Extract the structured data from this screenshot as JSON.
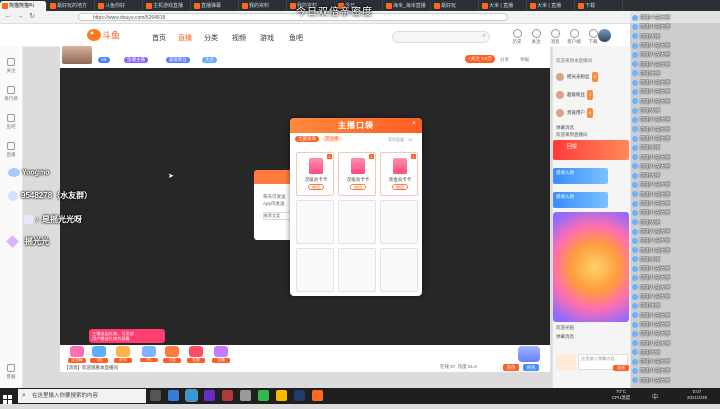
{
  "overlay_title": "今日双倍亲密度",
  "browser": {
    "tabs": [
      "熊猫熊猫叫",
      "最好玩的地方",
      "斗鱼你好",
      "主机游戏直播",
      "直播弹幕",
      "我的资料",
      "我的资料",
      "今日",
      "海米_海米直播",
      "最好玩",
      "大米 | 直播",
      "大米 | 直播",
      "下载"
    ],
    "active_tab": 0,
    "url": "https://www.douyu.com/5264818",
    "back": "←",
    "forward": "→",
    "refresh": "↻"
  },
  "header": {
    "logo": "斗鱼",
    "nav": [
      "首页",
      "直播",
      "分类",
      "视频",
      "游戏",
      "鱼吧"
    ],
    "active_nav": 1,
    "icons": [
      "历史",
      "关注",
      "消息",
      "客户端",
      "下载"
    ]
  },
  "sidebar": {
    "items": [
      "关注",
      "排行榜",
      "鱼吧",
      "直播",
      "客服"
    ]
  },
  "streamer": {
    "badges": [
      "V8",
      "鱼塘主播",
      "超级粉丝",
      "大大"
    ],
    "follow": "+关注",
    "follow_count": "3.9万",
    "share": "分享",
    "report": "举报"
  },
  "overlays": {
    "qq_prefix": "Yoogmo",
    "qq_group": "9548278（水友群）",
    "tiktok_label": "是摇光光呀",
    "name": "摇光光"
  },
  "back_card": {
    "line1": "每天可发送",
    "line2": "App内发送",
    "line3": "推荐文案"
  },
  "modal": {
    "title": "主播口袋",
    "close": "×",
    "tabs": [
      "全部道具",
      "荧光棒"
    ],
    "active_tab": 0,
    "help": "背包容量：15",
    "cards": [
      {
        "name": "次级贡卡卡",
        "count": "1",
        "action": "使用"
      },
      {
        "name": "次级贡卡卡",
        "count": "1",
        "action": "使用"
      },
      {
        "name": "黑金贡卡卡",
        "count": "1",
        "action": "使用"
      }
    ]
  },
  "gifts": [
    {
      "label": "荧光棒",
      "color": "#ff6fb0"
    },
    {
      "label": "飞机",
      "color": "#5ab0ff"
    },
    {
      "label": "办卡",
      "color": "#ffb14a"
    },
    {
      "label": "PK",
      "color": "#7fb2ff"
    },
    {
      "label": "火箭",
      "color": "#ff7a3d"
    },
    {
      "label": "礼物",
      "color": "#ff4a6a"
    },
    {
      "label": "宝箱",
      "color": "#c47bff"
    }
  ],
  "toast": {
    "line1": "主播送出礼物，可发放",
    "line2": "用户赠送礼物为观看",
    "line3": "更多详情"
  },
  "notice": "【消息】欢迎观看本直播间",
  "stats": {
    "viewers": "在线 87",
    "hot": "热度 51.8",
    "recharge": "充值",
    "backpack": "背包"
  },
  "chat": {
    "header": "欢迎来到本直播间",
    "ranks": [
      {
        "name": "摇光光粉丝",
        "lv": "8"
      },
      {
        "name": "超级粉丝",
        "lv": "7"
      },
      {
        "name": "贵族用户",
        "lv": "6"
      }
    ],
    "lines": [
      "弹幕消息",
      "欢迎来到直播间",
      "欢迎光临",
      "弹幕消息",
      "欢迎进入直播间",
      "欢迎",
      "送出礼物",
      "弹幕消息"
    ],
    "red_banner": "回报",
    "blue1": "感谢入场",
    "blue2": "感谢入场",
    "input_placeholder": "这里输入弹幕内容",
    "send": "发送"
  },
  "danmu": [
    "感谢八戒大佬",
    "感谢八戒大佬",
    "感谢大佬",
    "感谢八戒大佬",
    "感谢八戒大佬",
    "感谢八戒大佬",
    "感谢大佬",
    "感谢八戒大佬",
    "感谢八戒大佬",
    "感谢八戒大佬",
    "感谢大佬",
    "感谢八戒大佬",
    "感谢八戒大佬",
    "感谢八戒大佬",
    "感谢大佬",
    "感谢八戒大佬",
    "感谢八戒大佬",
    "感谢大佬",
    "感谢八戒大佬",
    "感谢八戒大佬",
    "感谢八戒大佬",
    "感谢八戒大佬",
    "感谢大佬",
    "感谢八戒大佬",
    "感谢八戒大佬",
    "感谢八戒大佬",
    "感谢大佬",
    "感谢八戒大佬",
    "感谢八戒大佬",
    "感谢八戒大佬",
    "感谢八戒大佬",
    "感谢大佬",
    "感谢八戒大佬",
    "感谢八戒大佬",
    "感谢八戒大佬",
    "感谢八戒大佬",
    "感谢大佬",
    "感谢八戒大佬",
    "感谢八戒大佬",
    "感谢八戒大佬"
  ],
  "taskbar": {
    "search_placeholder": "在这里输入你要搜索的内容",
    "cpu_line1": "70°C",
    "cpu_line2": "CPU温度",
    "ime": "中",
    "time": "0:07",
    "date": "2021/2/28"
  }
}
